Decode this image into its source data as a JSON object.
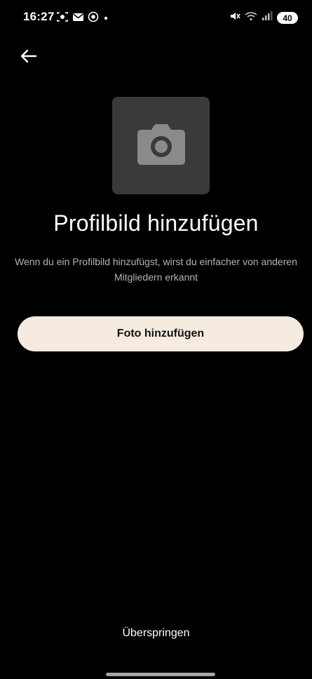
{
  "status_bar": {
    "time": "16:27",
    "left_icons": [
      "screen-record-icon",
      "mail-icon",
      "camera-notification-icon",
      "dot-icon"
    ],
    "right_icons": [
      "mute-icon",
      "wifi-icon",
      "signal-icon"
    ],
    "battery": "40"
  },
  "nav": {
    "back_icon": "arrow-left-icon"
  },
  "avatar": {
    "icon": "camera-icon"
  },
  "title": "Profilbild hinzufügen",
  "description": "Wenn du ein Profilbild hinzufügst, wirst du einfacher von anderen Mitgliedern erkannt",
  "primary_button": "Foto hinzufügen",
  "skip_button": "Überspringen",
  "colors": {
    "background": "#000000",
    "placeholder": "#3a3a3a",
    "camera_icon": "#8a8a8a",
    "button_bg": "#f5ebe1",
    "description_text": "#b3b3b3"
  }
}
